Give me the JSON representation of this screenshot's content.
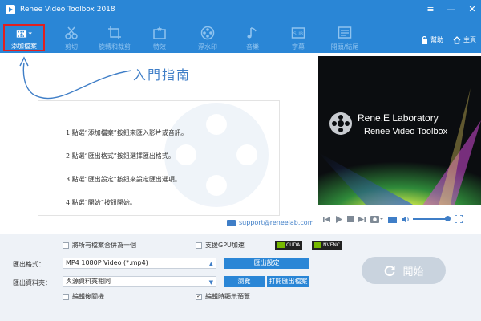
{
  "window": {
    "title": "Renee Video Toolbox 2018",
    "controls": [
      "≡",
      "—",
      "✕"
    ]
  },
  "toolbar": {
    "items": [
      {
        "label": "添加檔案",
        "icon": "add-file-icon",
        "active": true
      },
      {
        "label": "剪切",
        "icon": "cut-icon"
      },
      {
        "label": "旋轉和裁剪",
        "icon": "rotate-crop-icon"
      },
      {
        "label": "特效",
        "icon": "effects-icon"
      },
      {
        "label": "浮水印",
        "icon": "watermark-icon"
      },
      {
        "label": "音樂",
        "icon": "music-icon"
      },
      {
        "label": "字幕",
        "icon": "subtitle-icon"
      },
      {
        "label": "開頭/結尾",
        "icon": "intro-outro-icon"
      }
    ],
    "help_label": "幫助",
    "home_label": "主頁"
  },
  "guide": {
    "title": "入門指南",
    "steps": [
      "1.點選“添加檔案”按鈕來匯入影片或音訊。",
      "2.點選“匯出格式”按鈕選擇匯出格式。",
      "3.點選“匯出設定”按鈕來設定匯出選項。",
      "4.點選“開始”按鈕開始。"
    ],
    "support_email": "support@reneelab.com"
  },
  "preview": {
    "brand_line1": "Rene.E Laboratory",
    "brand_line2": "Renee Video Toolbox"
  },
  "bottom": {
    "merge_label": "將所有檔案合併為一個",
    "gpu_label": "支援GPU加速",
    "cuda_label": "CUDA",
    "nvenc_label": "NVENC",
    "format_label": "匯出格式：",
    "format_value": "MP4 1080P Video (*.mp4)",
    "export_settings_label": "匯出設定",
    "folder_label": "匯出資料夾：",
    "folder_value": "與源資料夾相同",
    "browse_label": "瀏覽",
    "open_folder_label": "打開匯出檔案",
    "shutdown_label": "編輯後關機",
    "show_preview_label": "編輯時顯示預覽",
    "start_label": "開始"
  },
  "colors": {
    "accent": "#2a86d6",
    "highlight_border": "#e02020",
    "start_disabled": "#c9d3de"
  }
}
